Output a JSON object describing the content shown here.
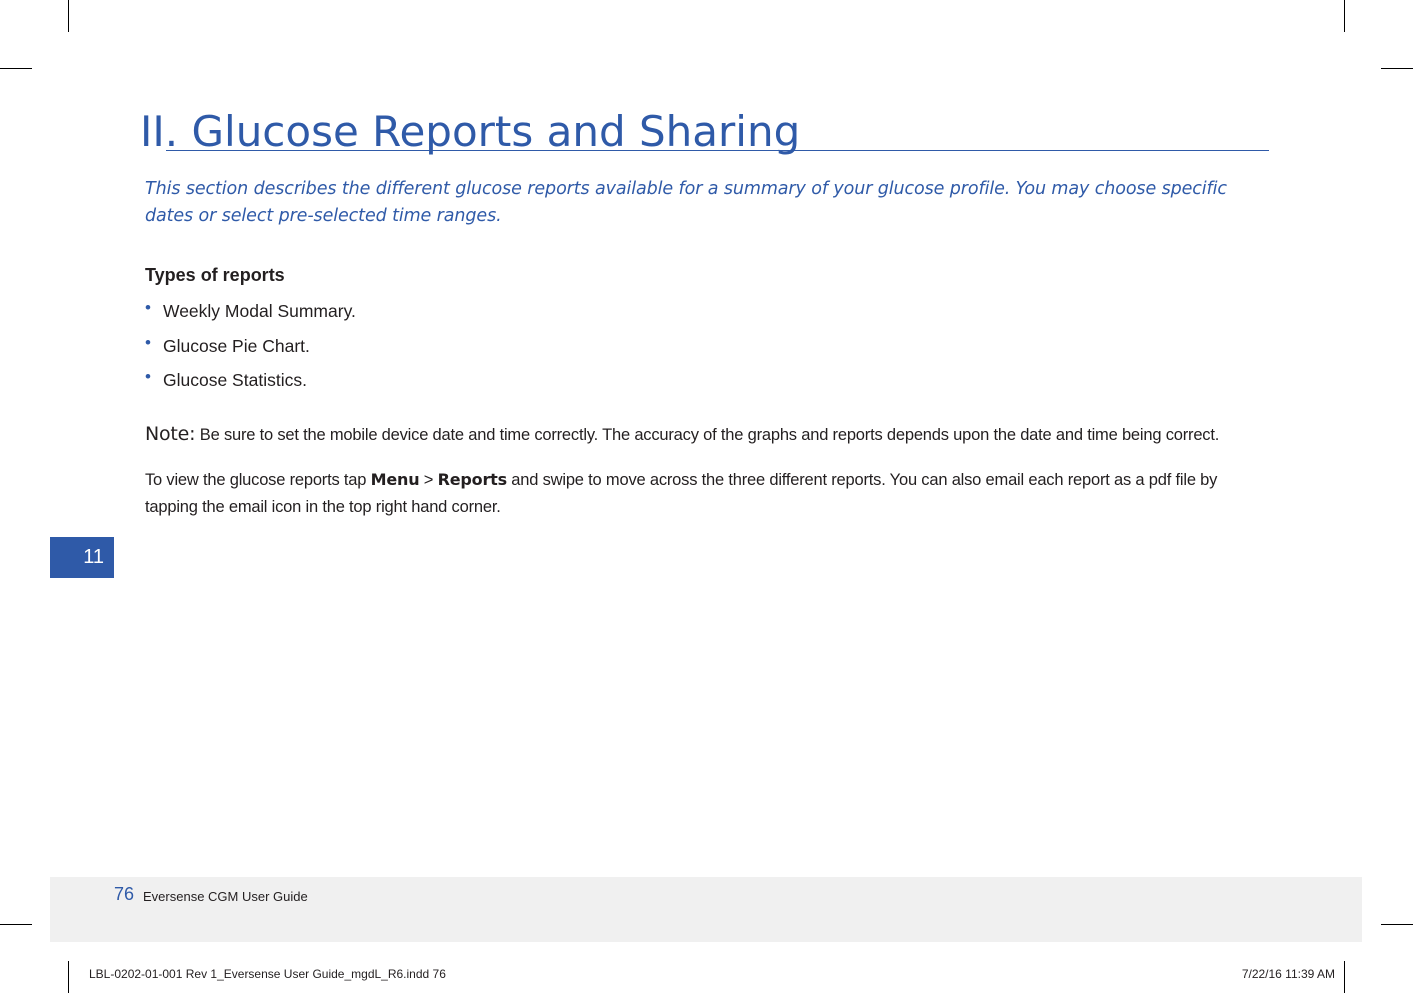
{
  "header": {
    "title": "II. Glucose Reports and Sharing",
    "intro": "This section describes the different glucose reports available for a summary of your glucose profile. You may choose specific dates or select pre-selected time ranges."
  },
  "types_of_reports": {
    "heading": "Types of reports",
    "items": [
      "Weekly Modal Summary.",
      "Glucose Pie Chart.",
      "Glucose Statistics."
    ]
  },
  "note": {
    "label": "Note:",
    "text": " Be sure to set the mobile device date and time correctly. The accuracy of the graphs and reports depends upon the date and time being correct."
  },
  "instructions": {
    "part1": "To view the glucose reports tap ",
    "menu": "Menu",
    "separator": " > ",
    "reports": "Reports",
    "part2": " and swipe to move across the three different reports. You can also email each report as a pdf file by tapping the email icon in the top right hand corner."
  },
  "chapter_tab": "11",
  "footer": {
    "page_number": "76",
    "guide_name": "Eversense CGM User Guide"
  },
  "slug": {
    "file": "LBL-0202-01-001 Rev 1_Eversense User Guide_mgdL_R6.indd   76",
    "timestamp": "7/22/16   11:39 AM"
  },
  "colors": {
    "accent": "#2f5aa8",
    "body_text": "#231f20",
    "footer_band": "#f0f0f0"
  }
}
